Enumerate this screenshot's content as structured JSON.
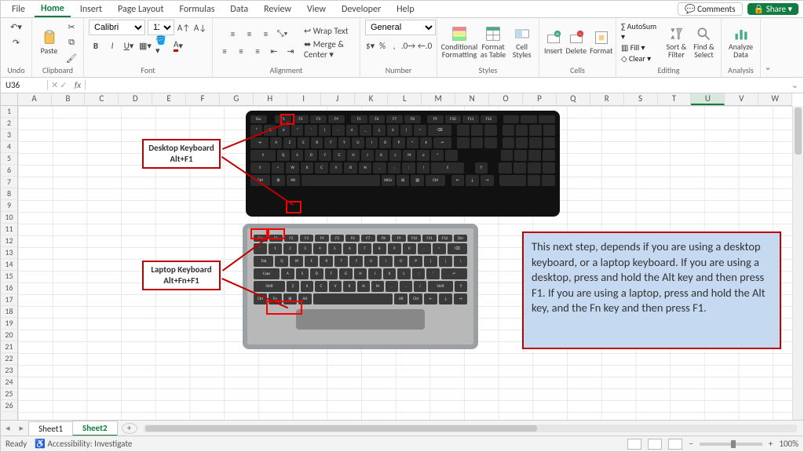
{
  "tabs": [
    "File",
    "Home",
    "Insert",
    "Page Layout",
    "Formulas",
    "Data",
    "Review",
    "View",
    "Developer",
    "Help"
  ],
  "active_tab": "Home",
  "comments_btn": "Comments",
  "share_btn": "Share",
  "ribbon": {
    "undo": {
      "label": "Undo"
    },
    "clipboard": {
      "paste": "Paste",
      "label": "Clipboard"
    },
    "font": {
      "name": "Calibri",
      "size": "11",
      "label": "Font"
    },
    "alignment": {
      "wrap": "Wrap Text",
      "merge": "Merge & Center",
      "label": "Alignment"
    },
    "number": {
      "format": "General",
      "label": "Number"
    },
    "styles": {
      "cond": "Conditional Formatting",
      "table": "Format as Table",
      "cell": "Cell Styles",
      "label": "Styles"
    },
    "cells": {
      "insert": "Insert",
      "delete": "Delete",
      "format": "Format",
      "label": "Cells"
    },
    "editing": {
      "autosum": "AutoSum",
      "fill": "Fill",
      "clear": "Clear",
      "sort": "Sort & Filter",
      "find": "Find & Select",
      "label": "Editing"
    },
    "analysis": {
      "analyze": "Analyze Data",
      "label": "Analysis"
    }
  },
  "namebox": "U36",
  "columns": [
    "A",
    "B",
    "C",
    "D",
    "E",
    "F",
    "G",
    "H",
    "I",
    "J",
    "K",
    "L",
    "M",
    "N",
    "O",
    "P",
    "Q",
    "R",
    "S",
    "T",
    "U",
    "V",
    "W"
  ],
  "active_col": "U",
  "row_count": 26,
  "callouts": {
    "desktop": "Desktop Keyboard\nAlt+F1",
    "laptop": "Laptop Keyboard\nAlt+Fn+F1"
  },
  "note": "This next step, depends if you are using a desktop keyboard, or a laptop keyboard. If you are using a desktop, press and hold the Alt key and then press F1.  If you are using a laptop, press and hold the Alt key, and the Fn key and then press F1.",
  "sheet_tabs": [
    "Sheet1",
    "Sheet2"
  ],
  "active_sheet": "Sheet2",
  "status": {
    "ready": "Ready",
    "access": "Accessibility: Investigate",
    "zoom": "100%"
  }
}
